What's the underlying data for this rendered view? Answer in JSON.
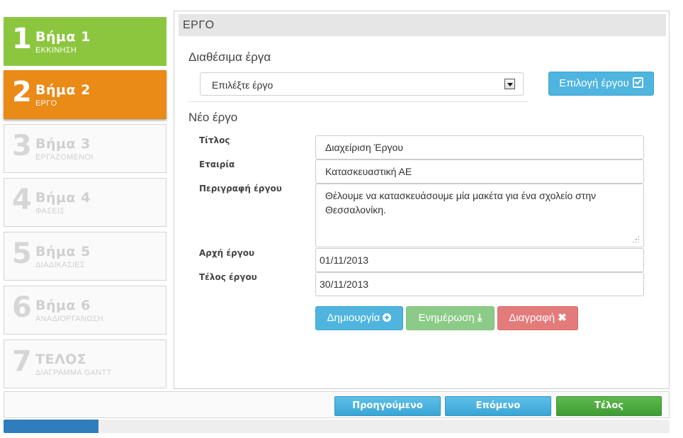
{
  "steps": [
    {
      "num": "1",
      "title": "Βήμα 1",
      "subtitle": "ΕΚΚΙΝΗΣΗ",
      "state": "done"
    },
    {
      "num": "2",
      "title": "Βήμα 2",
      "subtitle": "ΕΡΓΟ",
      "state": "active"
    },
    {
      "num": "3",
      "title": "Βήμα 3",
      "subtitle": "ΕΡΓΑΖΟΜΕΝΟΙ",
      "state": "pending"
    },
    {
      "num": "4",
      "title": "Βήμα 4",
      "subtitle": "ΦΑΣΕΙΣ",
      "state": "pending"
    },
    {
      "num": "5",
      "title": "Βήμα 5",
      "subtitle": "ΔΙΑΔΙΚΑΣΙΕΣ",
      "state": "pending"
    },
    {
      "num": "6",
      "title": "Βήμα 6",
      "subtitle": "ΑΝΑΔΙΟΡΓΑΝΩΣΗ",
      "state": "pending"
    },
    {
      "num": "7",
      "title": "ΤΕΛΟΣ",
      "subtitle": "ΔΙΑΓΡΑΜΜΑ GANTT",
      "state": "pending"
    }
  ],
  "panel": {
    "title": "ΕΡΓΟ",
    "available_heading": "Διαθέσιμα έργα",
    "select_value": "Επιλέξτε έργο",
    "select_button": "Επιλογή έργου",
    "new_heading": "Νέο έργο"
  },
  "form": {
    "title_label": "Τίτλος",
    "title_value": "Διαχείριση Έργου",
    "company_label": "Εταιρία",
    "company_value": "Κατασκευαστική ΑΕ",
    "description_label": "Περιγραφή έργου",
    "description_value": "Θέλουμε να κατασκευάσουμε μία μακέτα για ένα σχολείο στην Θεσσαλονίκη.",
    "start_label": "Αρχή έργου",
    "start_value": "01/11/2013",
    "end_label": "Τέλος έργου",
    "end_value": "30/11/2013"
  },
  "actions": {
    "create": "Δημιουργία",
    "update": "Ενημέρωση",
    "delete": "Διαγραφή"
  },
  "footer": {
    "previous": "Προηγούμενο",
    "next": "Επόμενο",
    "finish": "Τέλος"
  },
  "progress": {
    "fraction": 0.143
  },
  "icons": {
    "create": "plus-circle-icon",
    "update": "download-icon",
    "delete": "close-icon",
    "select": "check-square-icon",
    "dropdown": "chevron-down-icon"
  },
  "colors": {
    "step_done": "#8cc63f",
    "step_active": "#ea8a17",
    "btn_info": "#4fb5df",
    "btn_success": "#8ccb87",
    "btn_danger": "#e47b7b",
    "nav_finish": "#4aa83d",
    "progress": "#2f7dbd"
  }
}
